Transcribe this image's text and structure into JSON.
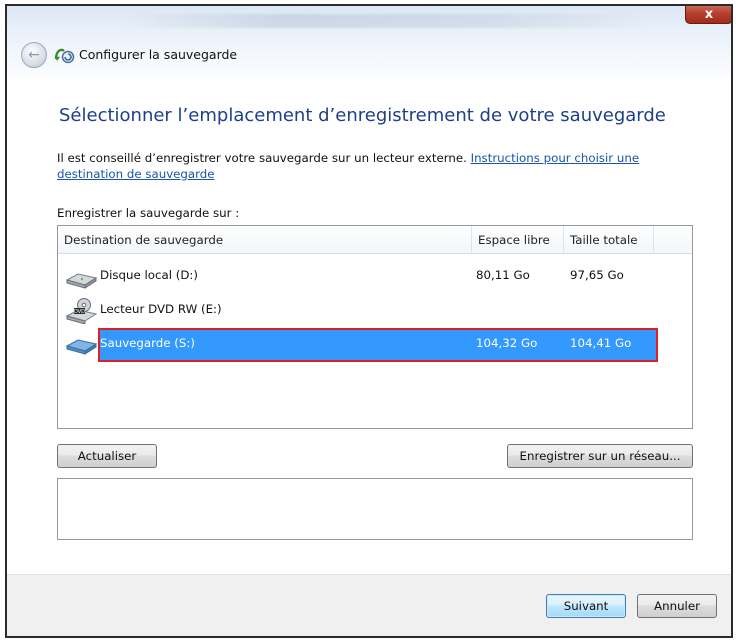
{
  "window": {
    "title": "Configurer la sauvegarde",
    "close_label": "x",
    "back_icon": "back-arrow-icon",
    "app_icon": "backup-icon"
  },
  "page": {
    "heading": "Sélectionner l’emplacement d’enregistrement de votre sauvegarde",
    "intro_text": "Il est conseillé d’enregistrer votre sauvegarde sur un lecteur externe. ",
    "intro_link": "Instructions pour choisir une destination de sauvegarde",
    "save_on_label": "Enregistrer la sauvegarde sur :"
  },
  "list": {
    "columns": [
      "Destination de sauvegarde",
      "Espace libre",
      "Taille totale"
    ],
    "rows": [
      {
        "icon": "hard-drive-icon",
        "name": "Disque local (D:)",
        "free": "80,11 Go",
        "total": "97,65 Go",
        "selected": false
      },
      {
        "icon": "dvd-drive-icon",
        "name": "Lecteur DVD RW (E:)",
        "free": "",
        "total": "",
        "selected": false
      },
      {
        "icon": "removable-drive-icon",
        "name": "Sauvegarde (S:)",
        "free": "104,32 Go",
        "total": "104,41 Go",
        "selected": true
      }
    ]
  },
  "buttons": {
    "refresh": "Actualiser",
    "save_network": "Enregistrer sur un réseau...",
    "next": "Suivant",
    "cancel": "Annuler"
  },
  "colors": {
    "selection": "#3399ff",
    "highlight_border": "#e02020",
    "heading": "#1d3f8c",
    "link": "#1a55a8"
  }
}
